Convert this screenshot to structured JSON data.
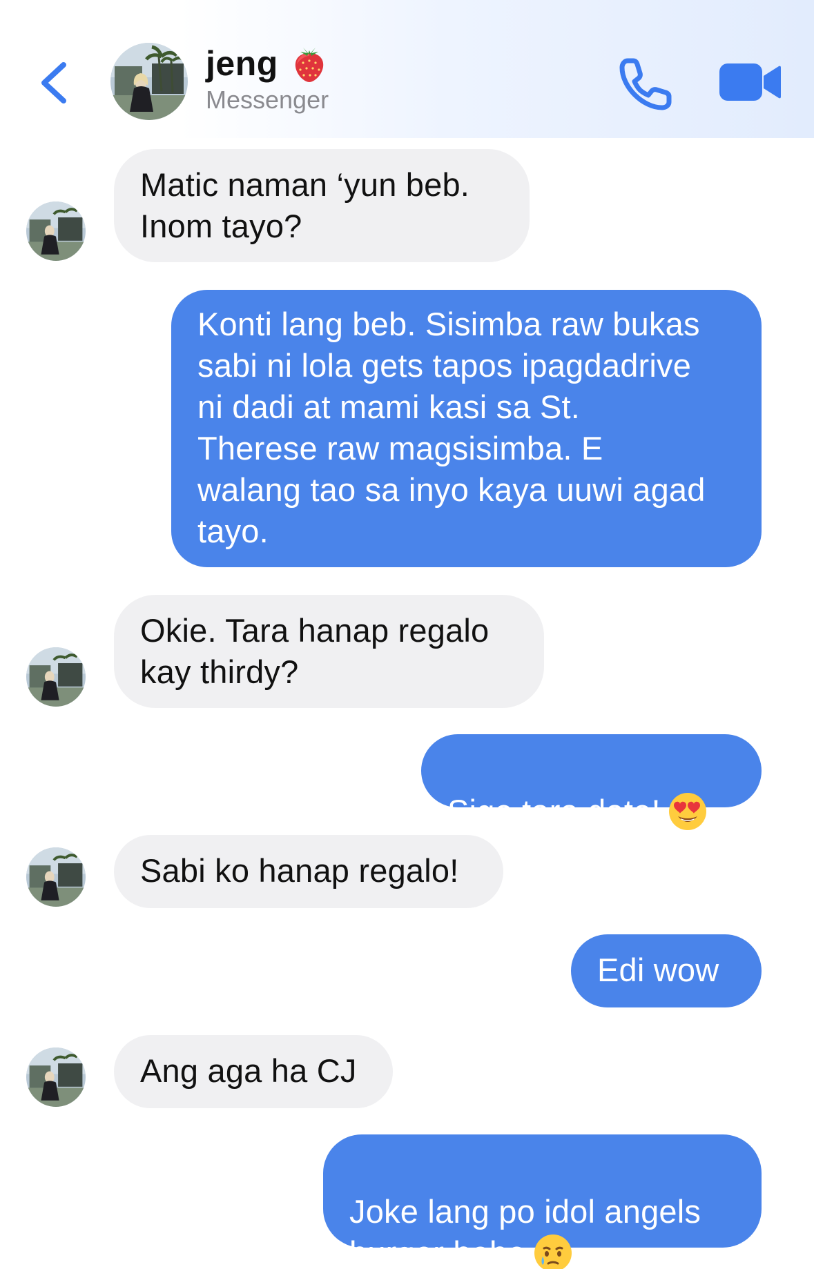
{
  "header": {
    "contact_name": "jeng",
    "subtitle": "Messenger",
    "icons": {
      "back": "chevron-left-icon",
      "phone": "phone-icon",
      "video": "video-camera-icon",
      "name_emoji": "strawberry-icon"
    },
    "accent_color": "#4a84ea"
  },
  "messages": [
    {
      "sender": "contact",
      "text": "Matic naman ‘yun beb.\nInom tayo?"
    },
    {
      "sender": "me",
      "text": "Konti lang beb. Sisimba raw bukas\nsabi ni lola gets tapos ipagdadrive\nni dadi at mami kasi sa St.\nTherese raw magsisimba. E\nwalang tao sa inyo kaya uuwi agad\ntayo."
    },
    {
      "sender": "contact",
      "text": "Okie. Tara hanap regalo\nkay thirdy?"
    },
    {
      "sender": "me",
      "text": "Sige tara date!",
      "emoji": "heart-eyes-emoji-icon"
    },
    {
      "sender": "contact",
      "text": "Sabi ko hanap regalo!"
    },
    {
      "sender": "me",
      "text": "Edi wow"
    },
    {
      "sender": "contact",
      "text": "Ang aga ha CJ"
    },
    {
      "sender": "me",
      "text": "Joke lang po idol angels\nburger bebe",
      "emoji": "tearful-smile-emoji-icon"
    }
  ],
  "colors": {
    "incoming_bubble": "#f0f0f2",
    "outgoing_bubble": "#4a84ea"
  }
}
